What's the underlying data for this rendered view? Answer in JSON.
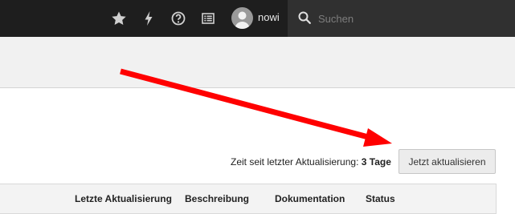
{
  "topbar": {
    "icons": [
      "star-icon",
      "bolt-icon",
      "help-icon",
      "list-icon"
    ],
    "username": "nowi",
    "search": {
      "placeholder": "Suchen"
    }
  },
  "status": {
    "label": "Zeit seit letzter Aktualisierung:",
    "value": "3 Tage"
  },
  "refresh_button": "Jetzt aktualisieren",
  "table": {
    "headers": [
      "Letzte Aktualisierung",
      "Beschreibung",
      "Dokumentation",
      "Status"
    ]
  },
  "colors": {
    "topbar": "#1e1e1e",
    "search": "#303030",
    "annotation_arrow": "#ff0000"
  }
}
